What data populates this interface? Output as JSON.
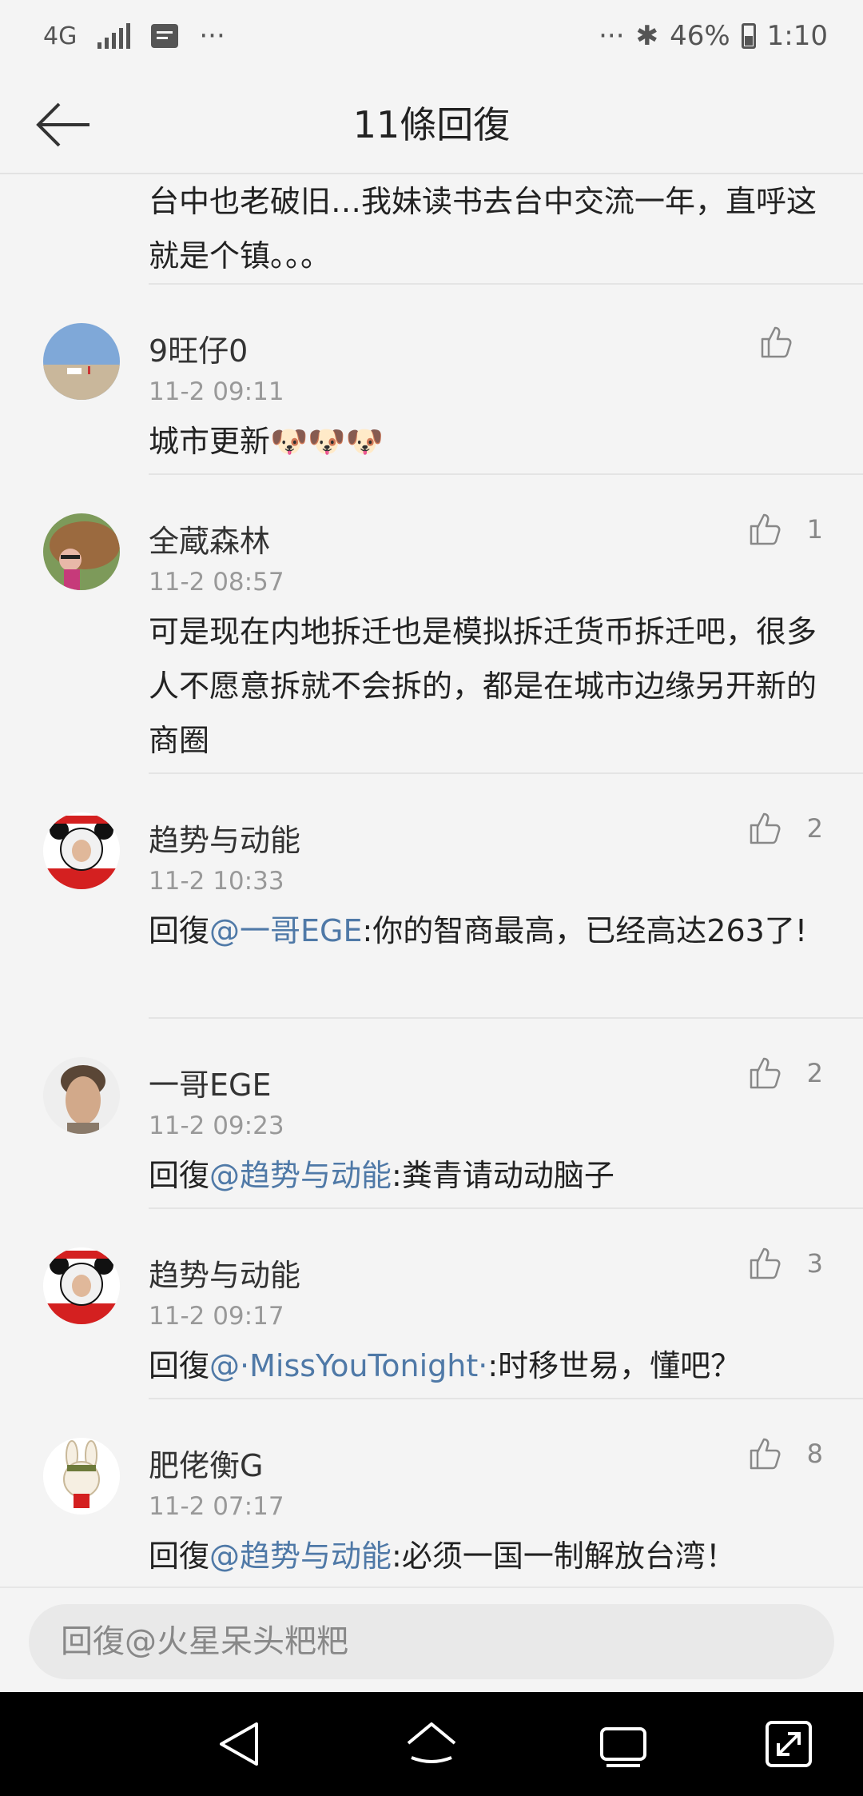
{
  "status_bar": {
    "network": "4G",
    "more_left": "···",
    "more_right": "···",
    "battery": "46%",
    "time": "1:10"
  },
  "header": {
    "title": "11條回復"
  },
  "partial_comment": {
    "text": "台中也老破旧…我妹读书去台中交流一年，直呼这就是个镇。。。"
  },
  "comments": [
    {
      "name": "9旺仔0",
      "time": "11-2 09:11",
      "text": "城市更新🐶🐶🐶",
      "mention": "",
      "reply_prefix": "",
      "likes": ""
    },
    {
      "name": "全蔵森林",
      "time": "11-2 08:57",
      "text": "可是现在内地拆迁也是模拟拆迁货币拆迁吧，很多人不愿意拆就不会拆的，都是在城市边缘另开新的商圈",
      "mention": "",
      "reply_prefix": "",
      "likes": "1"
    },
    {
      "name": "趋势与动能",
      "time": "11-2 10:33",
      "reply_prefix": "回復",
      "mention": "@一哥EGE",
      "text": ":你的智商最高，已经高达263了!",
      "likes": "2"
    },
    {
      "name": "一哥EGE",
      "time": "11-2 09:23",
      "reply_prefix": "回復",
      "mention": "@趋势与动能",
      "text": ":粪青请动动脑子",
      "likes": "2"
    },
    {
      "name": "趋势与动能",
      "time": "11-2 09:17",
      "reply_prefix": "回復",
      "mention": "@·MissYouTonight·",
      "text": ":时移世易，懂吧？",
      "likes": "3"
    },
    {
      "name": "肥佬衡G",
      "time": "11-2 07:17",
      "reply_prefix": "回復",
      "mention": "@趋势与动能",
      "text": ":必须一国一制解放台湾！",
      "likes": "8"
    }
  ],
  "reply_input": {
    "placeholder": "回復@火星呆头粑粑"
  },
  "icons": {
    "back": "arrow-left-icon",
    "like": "thumbs-up-icon",
    "nav_back": "triangle-back-icon",
    "nav_home": "home-icon",
    "nav_recent": "recent-apps-icon",
    "nav_expand": "expand-icon"
  },
  "colors": {
    "mention": "#4f79a7",
    "background": "#f4f4f4",
    "nav_bar": "#000000"
  }
}
